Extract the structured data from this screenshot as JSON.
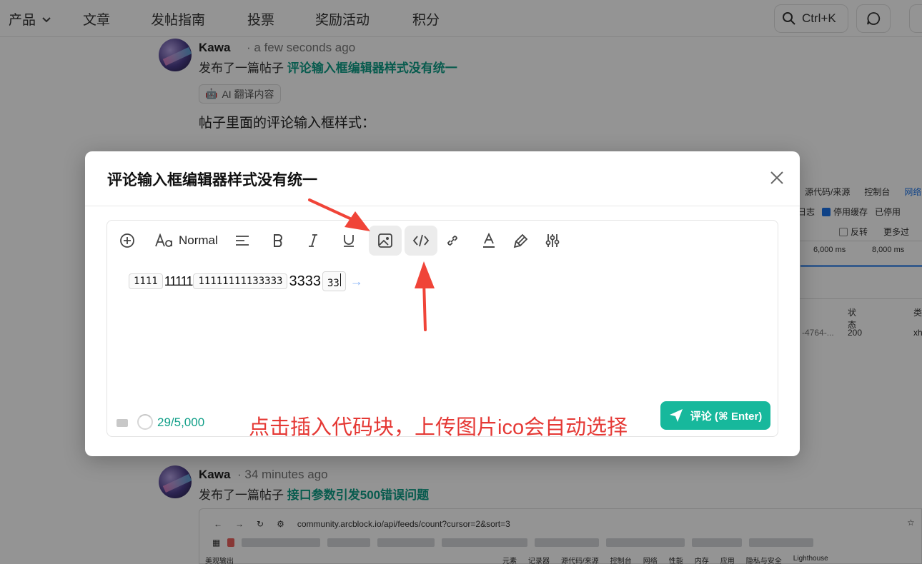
{
  "nav": {
    "items": [
      "产品",
      "文章",
      "发帖指南",
      "投票",
      "奖励活动",
      "积分"
    ],
    "search_shortcut": "Ctrl+K"
  },
  "feed": [
    {
      "author": "Kawa",
      "time": "a few seconds ago",
      "action": "发布了一篇帖子",
      "post_title": "评论输入框编辑器样式没有统一",
      "ai_badge": "AI 翻译内容",
      "body": "帖子里面的评论输入框样式："
    },
    {
      "author": "Kawa",
      "time": "34 minutes ago",
      "action": "发布了一篇帖子",
      "post_title": "接口参数引发500错误问题"
    }
  ],
  "devtools": {
    "tabs": [
      "源代码/来源",
      "控制台",
      "网络"
    ],
    "row2": [
      "日志",
      "停用缓存",
      "已停用"
    ],
    "row3": [
      "反转",
      "更多过"
    ],
    "ms_labels": [
      "6,000 ms",
      "8,000 ms"
    ],
    "col_status": "状态",
    "col_type": "类",
    "cell_name": "-4764-...",
    "cell_status": "200",
    "cell_type": "xh"
  },
  "browser": {
    "url": "community.arcblock.io/api/feeds/count?cursor=2&sort=3",
    "bottom_label": "美观输出",
    "bottom_tabs": [
      "元素",
      "记录器",
      "源代码/来源",
      "控制台",
      "网络",
      "性能",
      "内存",
      "应用",
      "隐私与安全",
      "Lighthouse"
    ]
  },
  "modal": {
    "title": "评论输入框编辑器样式没有统一",
    "toolbar": {
      "heading_style": "Normal"
    },
    "content": {
      "code1": "1111",
      "text1": "11111",
      "code2": "11111111133333",
      "text2": "3333",
      "code3": "33"
    },
    "annotation": "点击插入代码块，上传图片ico会自动选择",
    "counter": "29/5,000",
    "submit_label": "评论 (⌘ Enter)"
  },
  "colors": {
    "accent": "#17b89c",
    "link": "#0f9e87",
    "annotation": "#e53935"
  }
}
